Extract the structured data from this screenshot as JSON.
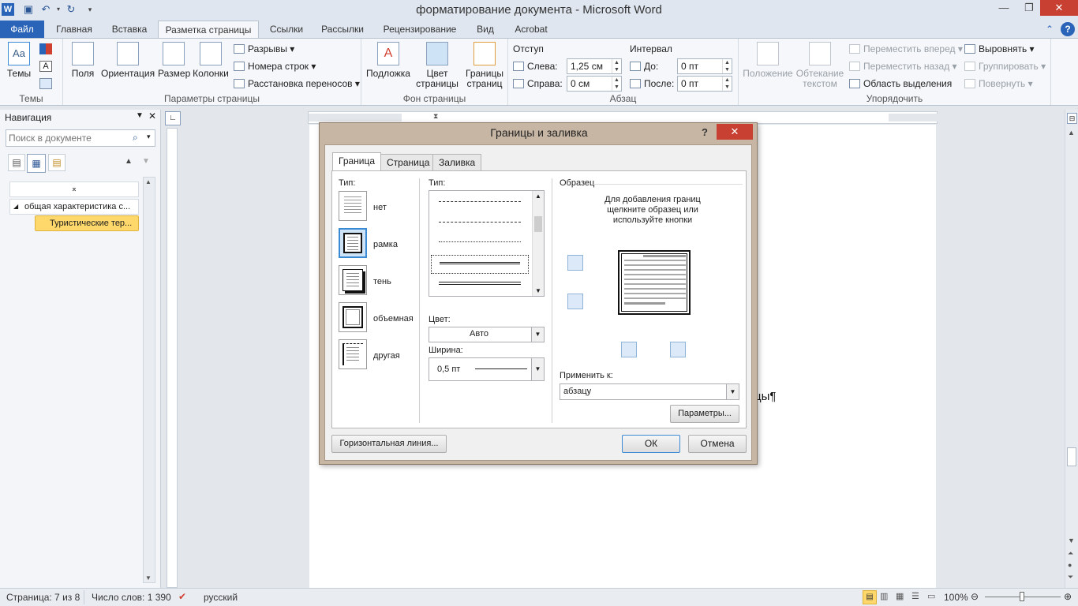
{
  "window": {
    "title": "форматирование документа  -  Microsoft Word",
    "app_icon": "word-icon",
    "min": "—",
    "restore": "❐",
    "close": "✕"
  },
  "ribbon_tabs": [
    "Файл",
    "Главная",
    "Вставка",
    "Разметка страницы",
    "Ссылки",
    "Рассылки",
    "Рецензирование",
    "Вид",
    "Acrobat"
  ],
  "ribbon": {
    "themes": {
      "label": "Темы",
      "group": "Темы"
    },
    "page_setup": {
      "group": "Параметры страницы",
      "margins": "Поля",
      "orientation": "Ориентация",
      "size": "Размер",
      "columns": "Колонки",
      "breaks": "Разрывы ▾",
      "line_numbers": "Номера строк ▾",
      "hyphenation": "Расстановка переносов ▾"
    },
    "page_background": {
      "group": "Фон страницы",
      "watermark": "Подложка",
      "page_color": "Цвет страницы",
      "page_borders": "Границы страниц"
    },
    "paragraph": {
      "group": "Абзац",
      "indent_label": "Отступ",
      "left_label": "Слева:",
      "left_value": "1,25 см",
      "right_label": "Справа:",
      "right_value": "0 см",
      "spacing_label": "Интервал",
      "before_label": "До:",
      "before_value": "0 пт",
      "after_label": "После:",
      "after_value": "0 пт"
    },
    "arrange": {
      "group": "Упорядочить",
      "position": "Положение",
      "wrap": "Обтекание текстом",
      "bring_forward": "Переместить вперед ▾",
      "send_backward": "Переместить назад ▾",
      "selection_pane": "Область выделения",
      "align": "Выровнять ▾",
      "group_btn": "Группировать ▾",
      "rotate": "Повернуть ▾"
    }
  },
  "nav": {
    "title": "Навигация",
    "search_placeholder": "Поиск в документе",
    "items": [
      "общая характеристика с...",
      "Туристические тер..."
    ]
  },
  "doc": {
    "visible_text": "цы¶"
  },
  "dialog": {
    "title": "Границы и заливка",
    "help": "?",
    "tabs": [
      "Граница",
      "Страница",
      "Заливка"
    ],
    "setting_label": "Тип:",
    "settings": [
      "нет",
      "рамка",
      "тень",
      "объемная",
      "другая"
    ],
    "style_label": "Тип:",
    "color_label": "Цвет:",
    "color_value": "Авто",
    "width_label": "Ширина:",
    "width_value": "0,5 пт",
    "preview_label": "Образец",
    "preview_hint": "Для добавления границ щелкните образец или используйте кнопки",
    "apply_label": "Применить к:",
    "apply_value": "абзацу",
    "options_button": "Параметры...",
    "hline_button": "Горизонтальная линия...",
    "ok": "ОК",
    "cancel": "Отмена"
  },
  "status": {
    "page": "Страница: 7 из 8",
    "words": "Число слов: 1 390",
    "language": "русский",
    "zoom": "100%"
  },
  "colors": {
    "accent": "#2a64b8",
    "selection": "#ffd86b",
    "dialog_frame": "#c7b6a3",
    "close_red": "#c84031"
  }
}
